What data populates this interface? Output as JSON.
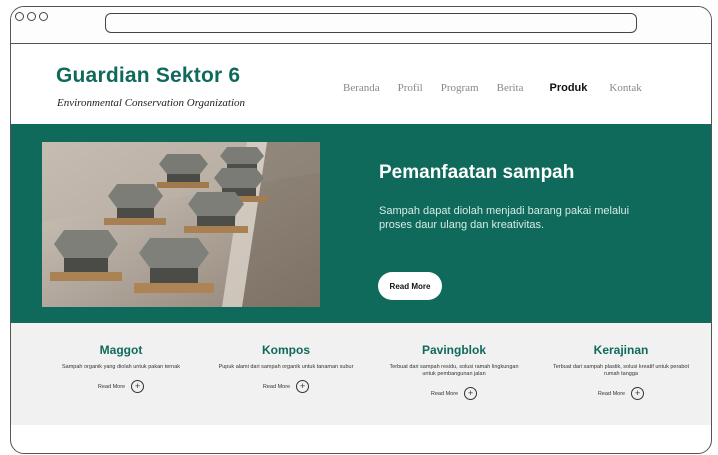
{
  "brand": {
    "title": "Guardian Sektor 6",
    "subtitle": "Environmental Conservation Organization"
  },
  "nav": {
    "items": [
      "Beranda",
      "Profil",
      "Program",
      "Berita",
      "Produk",
      "Kontak"
    ],
    "active": "Produk"
  },
  "hero": {
    "title": "Pemanfaatan sampah",
    "text": "Sampah dapat diolah menjadi barang pakai melalui proses daur ulang dan kreativitas.",
    "button": "Read More"
  },
  "products": [
    {
      "title": "Maggot",
      "desc": "Sampah organik yang diolah untuk pakan ternak",
      "more": "Read More"
    },
    {
      "title": "Kompos",
      "desc": "Pupuk alami dari sampah organik untuk tanaman subur",
      "more": "Read More"
    },
    {
      "title": "Pavingblok",
      "desc": "Terbuat dari sampah residu, solusi ramah lingkungan untuk pembangunan jalan",
      "more": "Read More"
    },
    {
      "title": "Kerajinan",
      "desc": "Terbuat dari sampah plastik, solusi kreatif untuk perabot rumah tangga",
      "more": "Read More"
    }
  ],
  "colors": {
    "primary": "#0f6a5c",
    "background": "#ffffff",
    "section_bg": "#f1f1f1"
  },
  "icons": {
    "read_more": "plus-circle-icon"
  }
}
